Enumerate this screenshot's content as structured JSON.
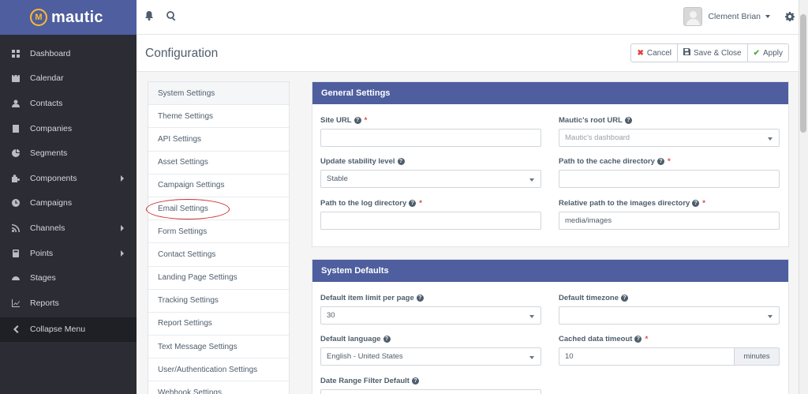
{
  "brand": {
    "name": "mautic"
  },
  "sidebar": {
    "items": [
      {
        "label": "Dashboard",
        "icon": "dashboard-icon"
      },
      {
        "label": "Calendar",
        "icon": "calendar-icon"
      },
      {
        "label": "Contacts",
        "icon": "user-icon"
      },
      {
        "label": "Companies",
        "icon": "building-icon"
      },
      {
        "label": "Segments",
        "icon": "pie-chart-icon"
      },
      {
        "label": "Components",
        "icon": "puzzle-icon",
        "has_submenu": true
      },
      {
        "label": "Campaigns",
        "icon": "clock-icon"
      },
      {
        "label": "Channels",
        "icon": "rss-icon",
        "has_submenu": true
      },
      {
        "label": "Points",
        "icon": "calculator-icon",
        "has_submenu": true
      },
      {
        "label": "Stages",
        "icon": "tachometer-icon"
      },
      {
        "label": "Reports",
        "icon": "line-chart-icon"
      }
    ],
    "collapse_label": "Collapse Menu"
  },
  "topbar": {
    "user_name": "Clement Brian"
  },
  "page": {
    "title": "Configuration"
  },
  "toolbar": {
    "cancel_label": "Cancel",
    "save_close_label": "Save & Close",
    "apply_label": "Apply"
  },
  "settings_nav": {
    "items": [
      "System Settings",
      "Theme Settings",
      "API Settings",
      "Asset Settings",
      "Campaign Settings",
      "Email Settings",
      "Form Settings",
      "Contact Settings",
      "Landing Page Settings",
      "Tracking Settings",
      "Report Settings",
      "Text Message Settings",
      "User/Authentication Settings",
      "Webhook Settings"
    ],
    "active": "System Settings",
    "highlighted": "Email Settings"
  },
  "general": {
    "heading": "General Settings",
    "site_url": {
      "label": "Site URL",
      "required": "*",
      "value": ""
    },
    "root_url": {
      "label": "Mautic's root URL",
      "placeholder": "Mautic's dashboard"
    },
    "stability": {
      "label": "Update stability level",
      "value": "Stable"
    },
    "cache_dir": {
      "label": "Path to the cache directory",
      "required": "*",
      "value": ""
    },
    "log_dir": {
      "label": "Path to the log directory",
      "required": "*",
      "value": ""
    },
    "images_dir": {
      "label": "Relative path to the images directory",
      "required": "*",
      "value": "media/images"
    }
  },
  "defaults": {
    "heading": "System Defaults",
    "item_limit": {
      "label": "Default item limit per page",
      "value": "30"
    },
    "timezone": {
      "label": "Default timezone",
      "value": ""
    },
    "language": {
      "label": "Default language",
      "value": "English - United States"
    },
    "cache_timeout": {
      "label": "Cached data timeout",
      "required": "*",
      "value": "10",
      "addon": "minutes"
    },
    "date_range": {
      "label": "Date Range Filter Default"
    }
  },
  "colors": {
    "brand": "#4e5e9e",
    "sidebar": "#2c2c35",
    "accent_orange": "#fdb933",
    "required": "#e0403d",
    "highlight": "#c9302c"
  }
}
